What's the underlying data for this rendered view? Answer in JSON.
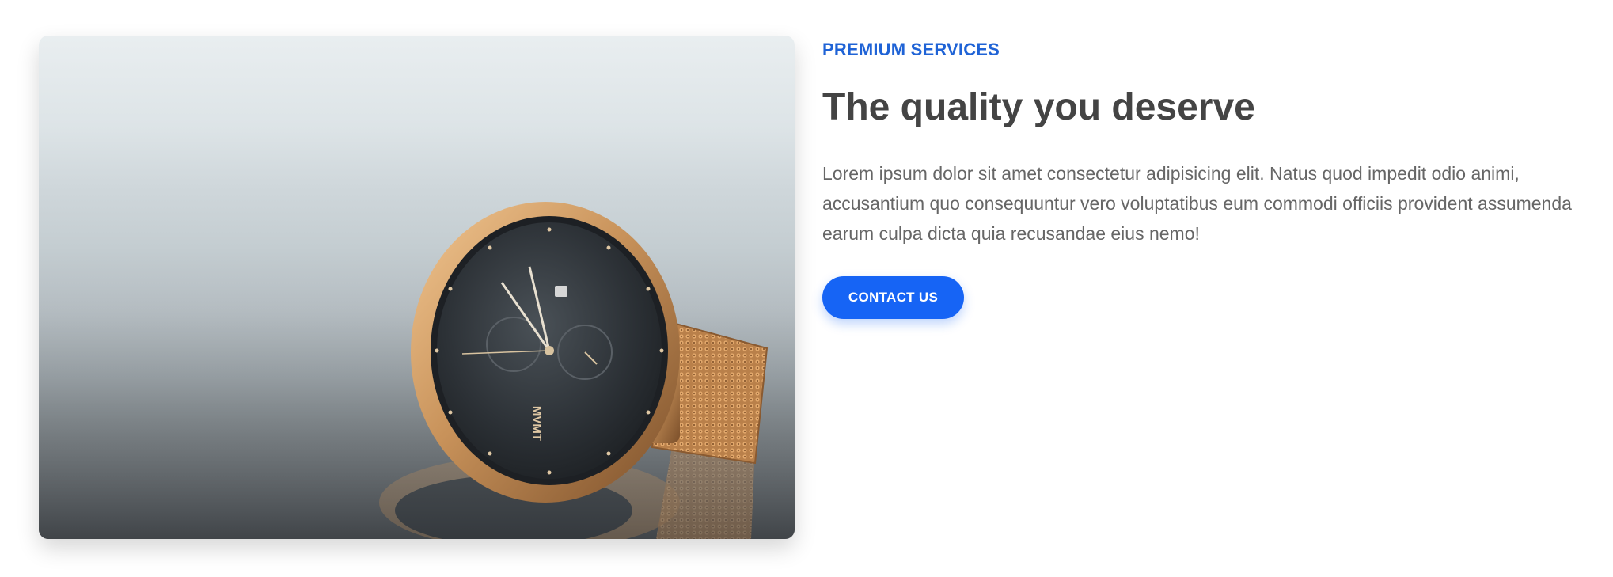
{
  "hero": {
    "image_alt": "Gold watch with black dial and mesh strap on reflective surface",
    "watch_brand_text": "MVMT"
  },
  "content": {
    "eyebrow": "PREMIUM SERVICES",
    "headline": "The quality you deserve",
    "body": "Lorem ipsum dolor sit amet consectetur adipisicing elit. Natus quod impedit odio animi, accusantium quo consequuntur vero voluptatibus eum commodi officiis provident assumenda earum culpa dicta quia recusandae eius nemo!",
    "cta_label": "CONTACT US"
  },
  "colors": {
    "accent": "#1664f5",
    "eyebrow": "#1f63d6",
    "headline": "#444444",
    "body": "#666666",
    "watch_gold": "#c8925a",
    "watch_dial": "#2c3136"
  }
}
